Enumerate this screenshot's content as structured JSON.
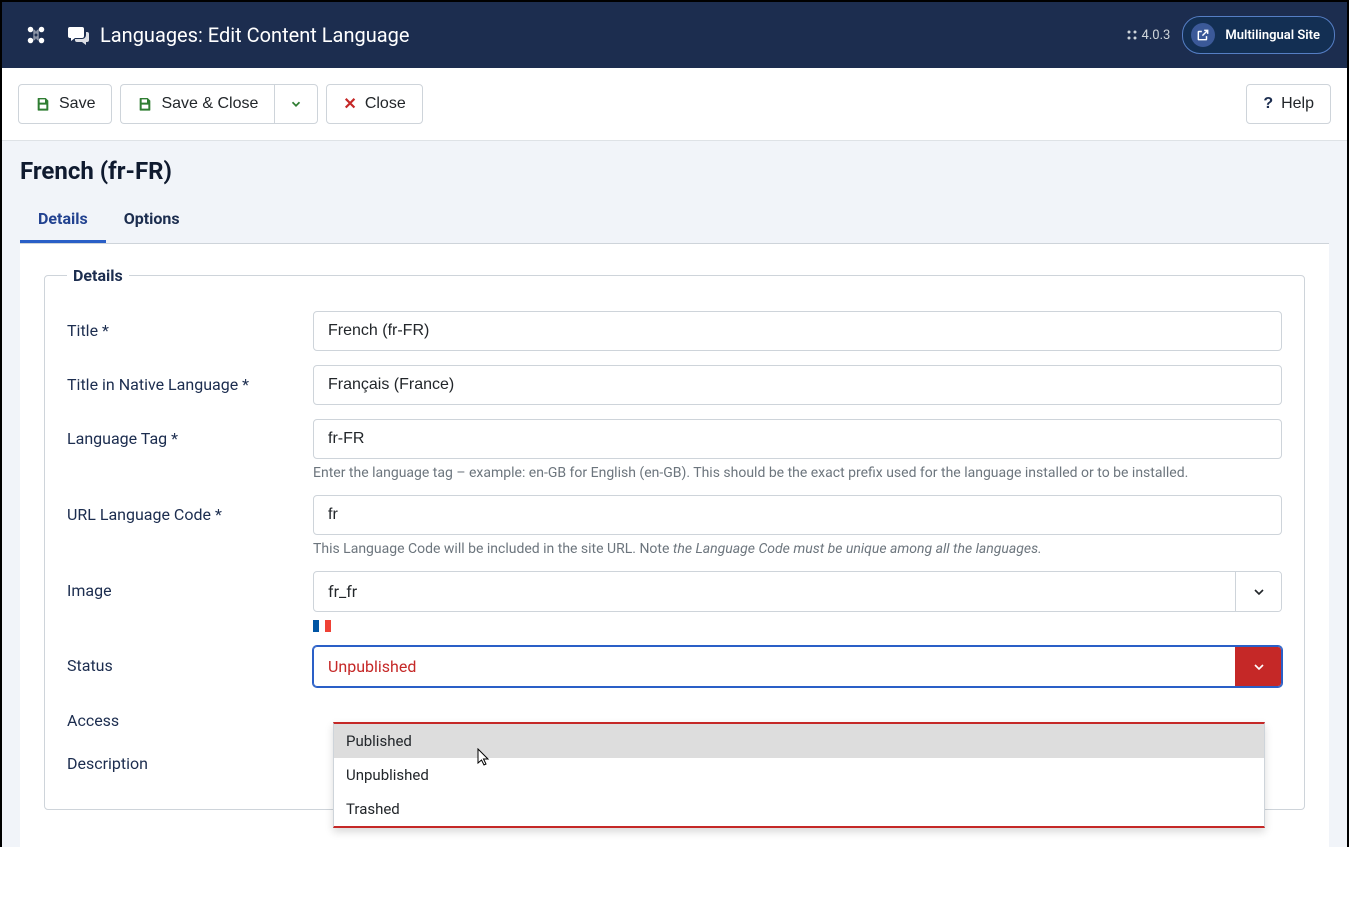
{
  "header": {
    "title": "Languages: Edit Content Language",
    "version": "4.0.3",
    "site_button": "Multilingual Site"
  },
  "toolbar": {
    "save": "Save",
    "save_close": "Save & Close",
    "close": "Close",
    "help": "Help"
  },
  "page_title": "French (fr-FR)",
  "tabs": {
    "details": "Details",
    "options": "Options"
  },
  "fieldset_legend": "Details",
  "fields": {
    "title": {
      "label": "Title *",
      "value": "French (fr-FR)"
    },
    "native": {
      "label": "Title in Native Language *",
      "value": "Français (France)"
    },
    "lang_tag": {
      "label": "Language Tag *",
      "value": "fr-FR",
      "hint": "Enter the language tag – example: en-GB for English (en-GB). This should be the exact prefix used for the language installed or to be installed."
    },
    "url_code": {
      "label": "URL Language Code *",
      "value": "fr",
      "hint_pre": "This Language Code will be included in the site URL. Note ",
      "hint_em": "the Language Code must be unique among all the languages."
    },
    "image": {
      "label": "Image",
      "value": "fr_fr"
    },
    "status": {
      "label": "Status",
      "value": "Unpublished",
      "options": [
        "Published",
        "Unpublished",
        "Trashed"
      ]
    },
    "access": {
      "label": "Access"
    },
    "description": {
      "label": "Description"
    }
  }
}
